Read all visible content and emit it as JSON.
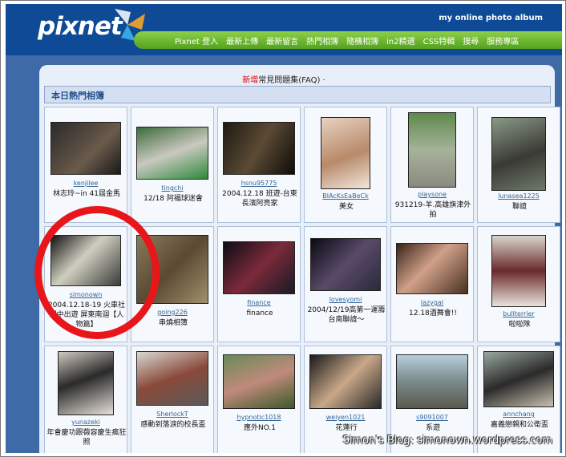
{
  "header": {
    "logo": "pixnet",
    "tagline": "my online photo album",
    "nav": [
      "Pixnet 登入",
      "最新上傳",
      "最新留言",
      "熱門相簿",
      "隨機相簿",
      "in2精選",
      "CSS特輯",
      "搜尋",
      "服務專區"
    ]
  },
  "faq": {
    "new_label": "新增",
    "text": "常見問題集(FAQ) ·"
  },
  "section_title": "本日熱門相簿",
  "albums": [
    {
      "owner": "kenjilee",
      "caption": "林志玲~in 41屆金馬"
    },
    {
      "owner": "tingchi",
      "caption": "12/18 阿福球迷會"
    },
    {
      "owner": "hsnu95775",
      "caption": "2004.12.18 班遊-台東長濱阿亮家"
    },
    {
      "owner": "BlAcKsEaBeCk",
      "caption": "美女"
    },
    {
      "owner": "playsone",
      "caption": "931219-羊.高雄旗津外拍"
    },
    {
      "owner": "lunasea1225",
      "caption": "聯誼"
    },
    {
      "owner": "simonown",
      "caption": "2004.12.18-19 火車社期中出遊 屏東南迴【人物篇】"
    },
    {
      "owner": "going226",
      "caption": "串燒相簿"
    },
    {
      "owner": "finance",
      "caption": "finance"
    },
    {
      "owner": "lovesyomi",
      "caption": "2004/12/19高第一運籌台南聯誼～"
    },
    {
      "owner": "lazygal",
      "caption": "12.18酒舞會!!"
    },
    {
      "owner": "bullterrier",
      "caption": "啦啦隊"
    },
    {
      "owner": "yunazeki",
      "caption": "年會慶功跟薇容慶生瘋狂照"
    },
    {
      "owner": "SherlockT",
      "caption": "感動到落淚的校長盃"
    },
    {
      "owner": "hypnotic1018",
      "caption": "應外NO.1"
    },
    {
      "owner": "weiyen1021",
      "caption": "花蓮行"
    },
    {
      "owner": "s9091007",
      "caption": "系遊"
    },
    {
      "owner": "annchang",
      "caption": "嘉義戀親和公衛盃"
    }
  ],
  "watermark": "Simon's Blog: simonown.wordpress.com",
  "colors": {
    "header": "#0e4a95",
    "nav": "#6ab935",
    "highlight_circle": "#e8161a",
    "new": "#e00000"
  }
}
